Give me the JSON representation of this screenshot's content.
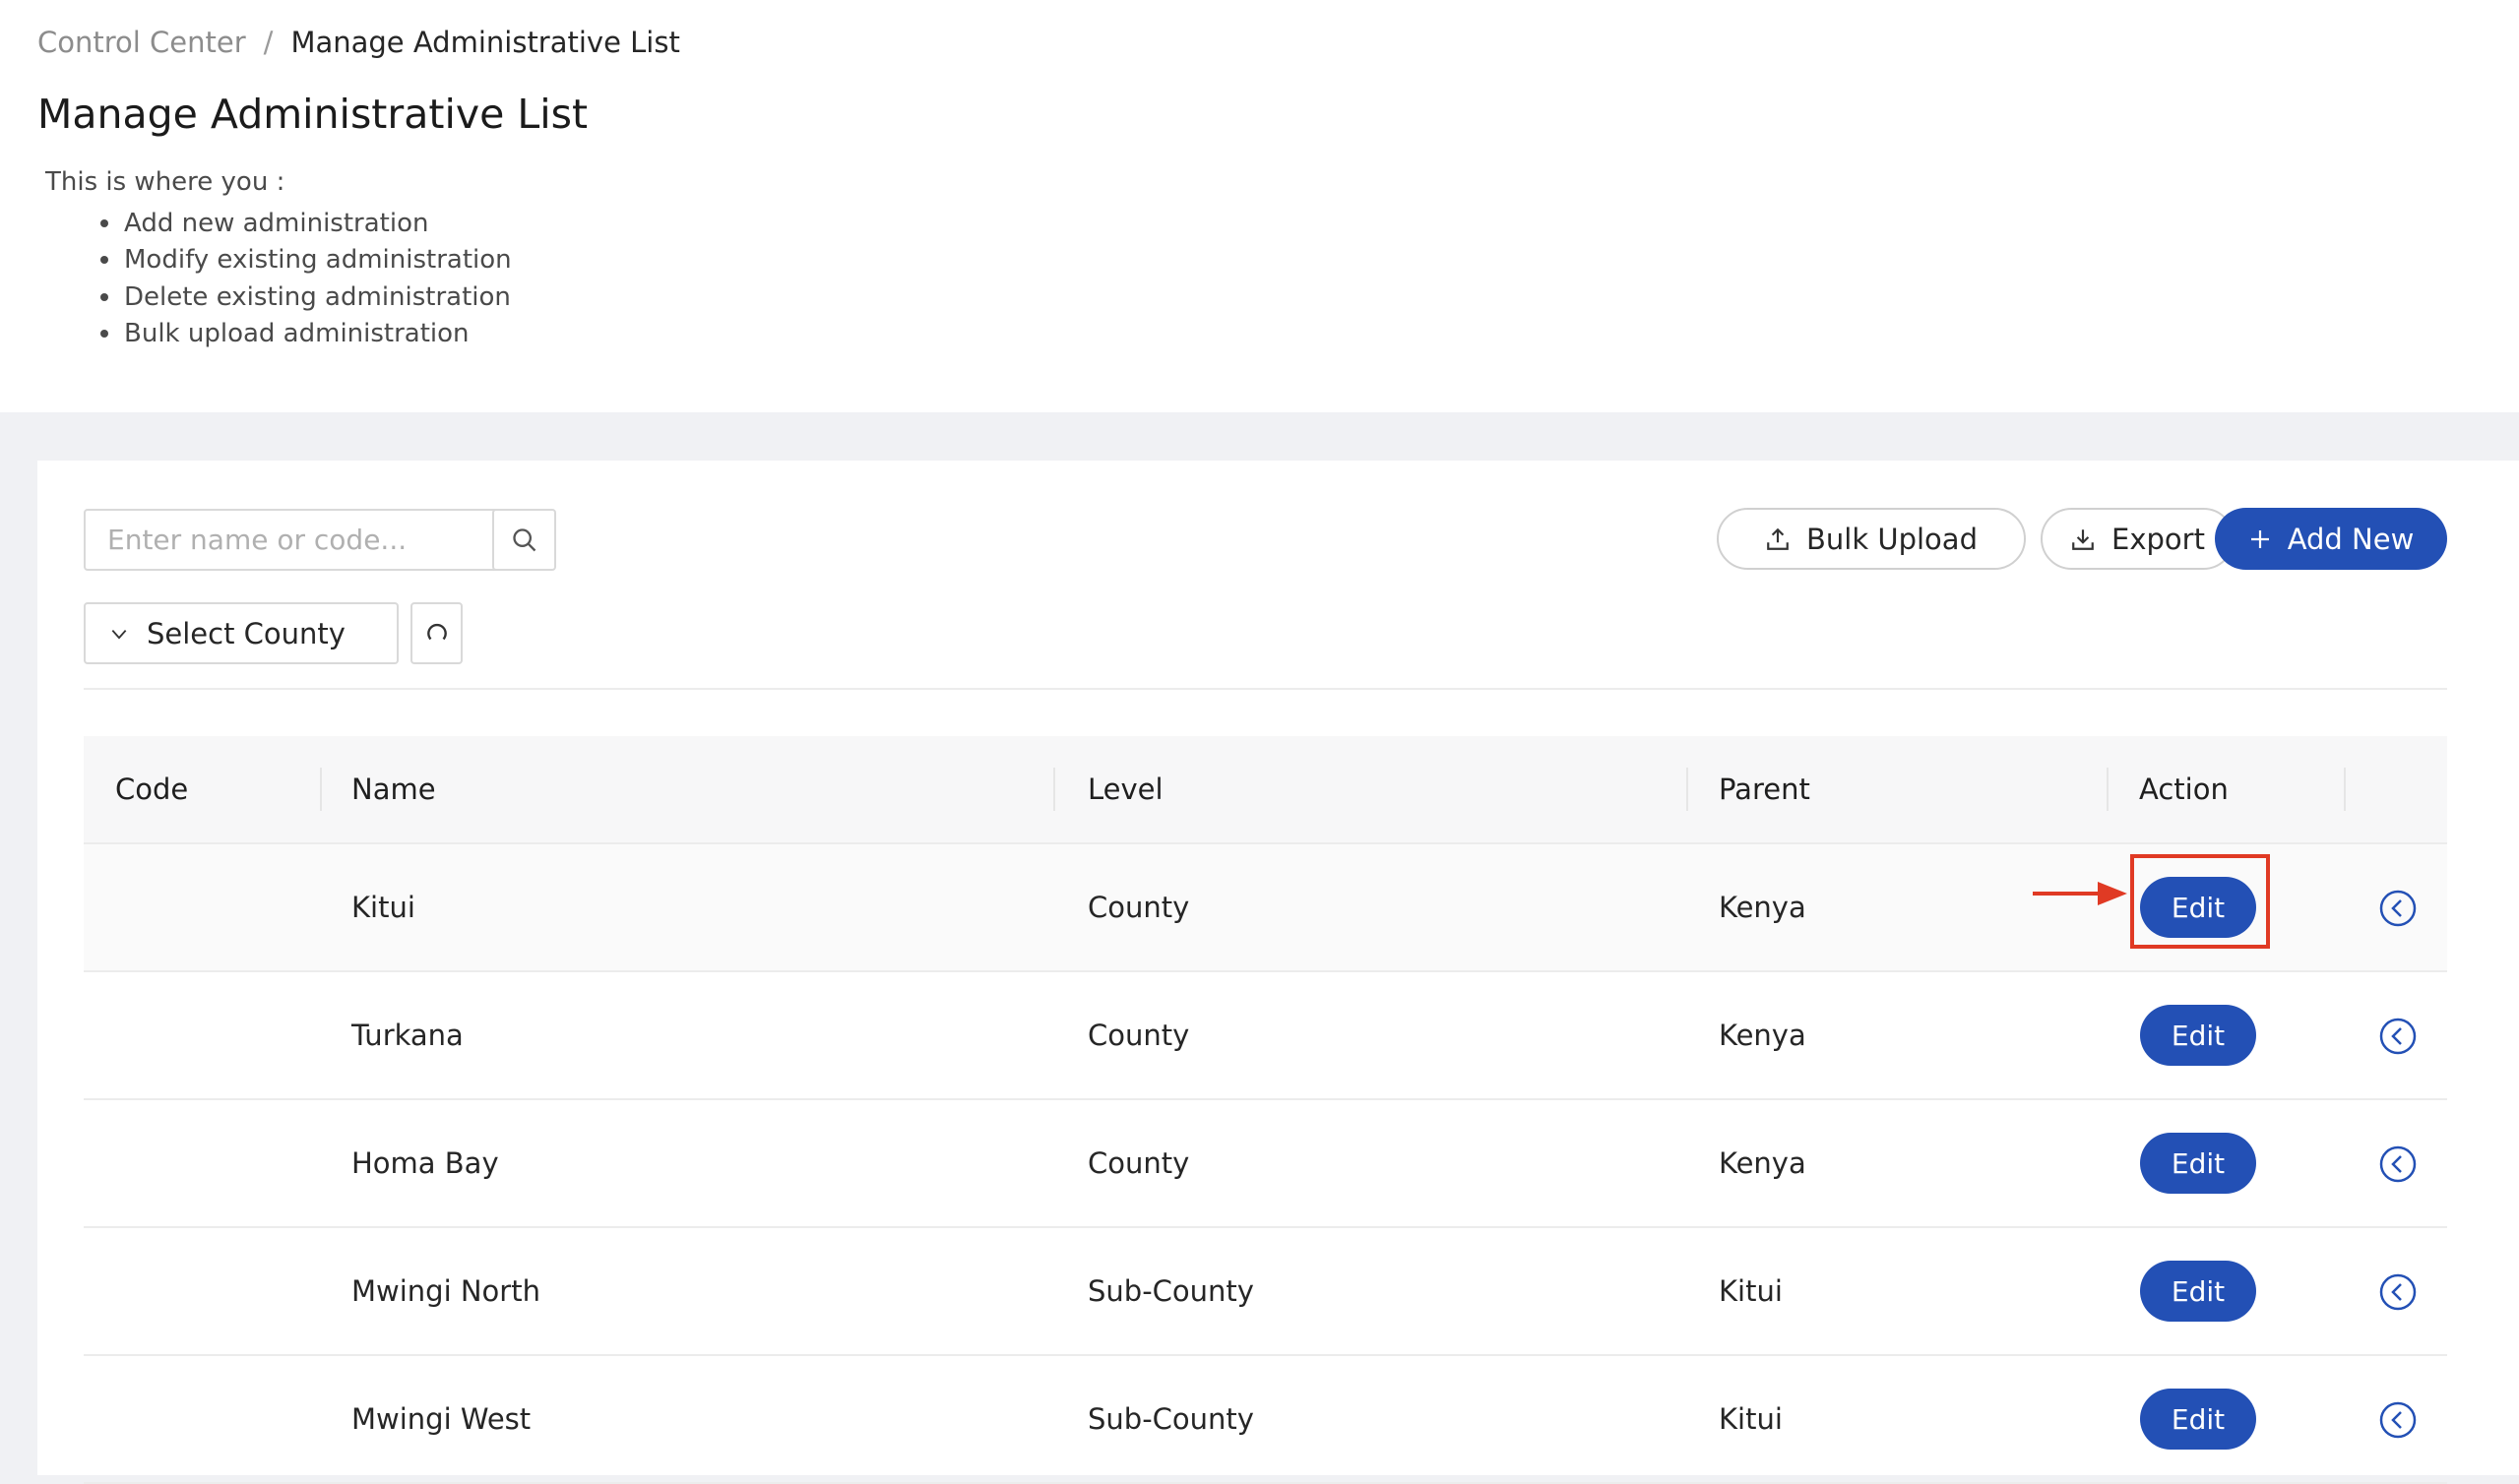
{
  "breadcrumb": {
    "parent": "Control Center",
    "separator": "/",
    "current": "Manage Administrative List"
  },
  "page": {
    "title": "Manage Administrative List",
    "intro": "This is where you :",
    "bullets": [
      "Add new administration",
      "Modify existing administration",
      "Delete existing administration",
      "Bulk upload administration"
    ]
  },
  "toolbar": {
    "search_placeholder": "Enter name or code...",
    "select_county": "Select County",
    "bulk_upload": "Bulk Upload",
    "export": "Export",
    "add_new": "Add New"
  },
  "table": {
    "columns": [
      "Code",
      "Name",
      "Level",
      "Parent",
      "Action"
    ],
    "rows": [
      {
        "code": "",
        "name": "Kitui",
        "level": "County",
        "parent": "Kenya",
        "action": "Edit"
      },
      {
        "code": "",
        "name": "Turkana",
        "level": "County",
        "parent": "Kenya",
        "action": "Edit"
      },
      {
        "code": "",
        "name": "Homa Bay",
        "level": "County",
        "parent": "Kenya",
        "action": "Edit"
      },
      {
        "code": "",
        "name": "Mwingi North",
        "level": "Sub-County",
        "parent": "Kitui",
        "action": "Edit"
      },
      {
        "code": "",
        "name": "Mwingi West",
        "level": "Sub-County",
        "parent": "Kitui",
        "action": "Edit"
      }
    ]
  },
  "colors": {
    "primary": "#2350b5",
    "annotation": "#e03a24"
  }
}
